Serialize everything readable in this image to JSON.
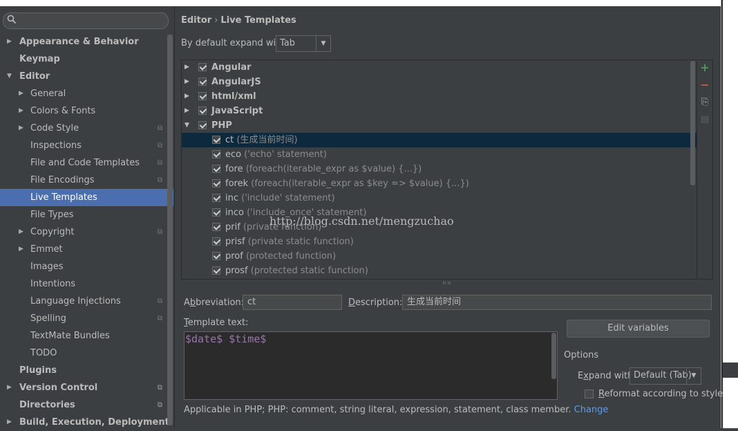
{
  "search": {
    "placeholder": ""
  },
  "sidebar": {
    "items": [
      {
        "label": "Appearance & Behavior",
        "bold": true,
        "arrow": "right",
        "indent": 0
      },
      {
        "label": "Keymap",
        "bold": true,
        "arrow": "",
        "indent": 0
      },
      {
        "label": "Editor",
        "bold": true,
        "arrow": "down",
        "indent": 0
      },
      {
        "label": "General",
        "bold": false,
        "arrow": "right",
        "indent": 1
      },
      {
        "label": "Colors & Fonts",
        "bold": false,
        "arrow": "right",
        "indent": 1
      },
      {
        "label": "Code Style",
        "bold": false,
        "arrow": "right",
        "indent": 1,
        "project": true
      },
      {
        "label": "Inspections",
        "bold": false,
        "arrow": "",
        "indent": 1,
        "project": true
      },
      {
        "label": "File and Code Templates",
        "bold": false,
        "arrow": "",
        "indent": 1,
        "project": true
      },
      {
        "label": "File Encodings",
        "bold": false,
        "arrow": "",
        "indent": 1,
        "project": true
      },
      {
        "label": "Live Templates",
        "bold": false,
        "arrow": "",
        "indent": 1,
        "selected": true
      },
      {
        "label": "File Types",
        "bold": false,
        "arrow": "",
        "indent": 1
      },
      {
        "label": "Copyright",
        "bold": false,
        "arrow": "right",
        "indent": 1,
        "project": true
      },
      {
        "label": "Emmet",
        "bold": false,
        "arrow": "right",
        "indent": 1
      },
      {
        "label": "Images",
        "bold": false,
        "arrow": "",
        "indent": 1
      },
      {
        "label": "Intentions",
        "bold": false,
        "arrow": "",
        "indent": 1
      },
      {
        "label": "Language Injections",
        "bold": false,
        "arrow": "",
        "indent": 1,
        "project": true
      },
      {
        "label": "Spelling",
        "bold": false,
        "arrow": "",
        "indent": 1,
        "project": true
      },
      {
        "label": "TextMate Bundles",
        "bold": false,
        "arrow": "",
        "indent": 1
      },
      {
        "label": "TODO",
        "bold": false,
        "arrow": "",
        "indent": 1
      },
      {
        "label": "Plugins",
        "bold": true,
        "arrow": "",
        "indent": 0
      },
      {
        "label": "Version Control",
        "bold": true,
        "arrow": "right",
        "indent": 0,
        "project": true
      },
      {
        "label": "Directories",
        "bold": true,
        "arrow": "",
        "indent": 0,
        "project": true
      },
      {
        "label": "Build, Execution, Deployment",
        "bold": true,
        "arrow": "right",
        "indent": 0
      }
    ]
  },
  "breadcrumb": {
    "part1": "Editor",
    "sep": "›",
    "part2": "Live Templates"
  },
  "expand": {
    "label": "By default expand with",
    "value": "Tab"
  },
  "tree": {
    "groups": [
      {
        "label": "Angular",
        "expanded": false
      },
      {
        "label": "AngularJS",
        "expanded": false
      },
      {
        "label": "html/xml",
        "expanded": false
      },
      {
        "label": "JavaScript",
        "expanded": false
      },
      {
        "label": "PHP",
        "expanded": true
      }
    ],
    "templates": [
      {
        "name": "ct",
        "desc": "(生成当前时间)",
        "selected": true
      },
      {
        "name": "eco",
        "desc": "('echo' statement)"
      },
      {
        "name": "fore",
        "desc": "(foreach(iterable_expr as $value) {...})"
      },
      {
        "name": "forek",
        "desc": "(foreach(iterable_expr as $key => $value) {...})"
      },
      {
        "name": "inc",
        "desc": "('include' statement)"
      },
      {
        "name": "inco",
        "desc": "('include_once' statement)"
      },
      {
        "name": "prif",
        "desc": "(private function)"
      },
      {
        "name": "prisf",
        "desc": "(private static function)"
      },
      {
        "name": "prof",
        "desc": "(protected function)"
      },
      {
        "name": "prosf",
        "desc": "(protected static function)"
      }
    ]
  },
  "tools": {
    "add": "+",
    "remove": "−",
    "copy": "⎘",
    "edit": "▤"
  },
  "watermark": "http://blog.csdn.net/mengzuchao",
  "abbreviation": {
    "label_pre": "A",
    "label_u": "b",
    "label_post": "breviation:",
    "value": "ct"
  },
  "description": {
    "label_u": "D",
    "label_post": "escription:",
    "value": "生成当前时间"
  },
  "template_text": {
    "label_u": "T",
    "label_post": "emplate text:",
    "value": "$date$ $time$"
  },
  "edit_variables": "Edit variables",
  "options": {
    "title": "Options",
    "expand_with_label_pre": "E",
    "expand_with_label_u": "x",
    "expand_with_label_post": "pand with",
    "expand_with_value": "Default (Tab)",
    "reformat_u": "R",
    "reformat_label": "eformat according to style"
  },
  "applicable": {
    "text": "Applicable in PHP; PHP: comment, string literal, expression, statement, class member.",
    "link": "Change"
  },
  "colors": {
    "selection": "#4b6eaf",
    "tree_selection": "#0d293e",
    "link": "#589df6",
    "template_var": "#9876aa"
  }
}
